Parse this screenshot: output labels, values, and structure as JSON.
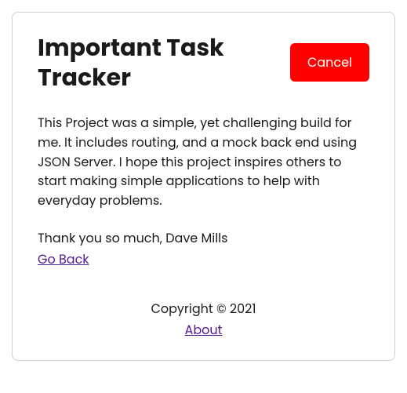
{
  "header": {
    "title": "Important Task Tracker",
    "cancel_label": "Cancel"
  },
  "content": {
    "description": "This Project was a simple, yet challenging build for me. It includes routing, and a mock back end using JSON Server. I hope this project inspires others to start making simple applications to help with everyday problems.",
    "thanks": "Thank you so much, Dave Mills",
    "go_back_label": "Go Back"
  },
  "footer": {
    "copyright": "Copyright © 2021",
    "about_label": "About"
  }
}
